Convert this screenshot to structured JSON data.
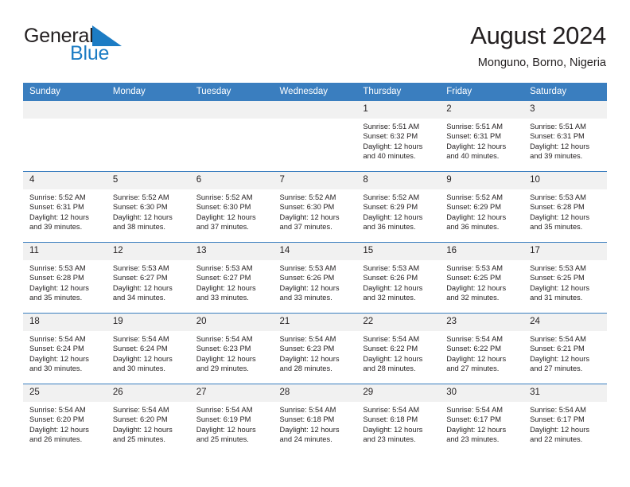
{
  "brand": {
    "name_part1": "General",
    "name_part2": "Blue",
    "logo_icon": "triangle-flag-icon",
    "accent_color": "#1c7cc4"
  },
  "header": {
    "title": "August 2024",
    "subtitle": "Monguno, Borno, Nigeria"
  },
  "calendar": {
    "header_bg": "#3a7ebf",
    "daynum_bg": "#f1f1f1",
    "weekday_headers": [
      "Sunday",
      "Monday",
      "Tuesday",
      "Wednesday",
      "Thursday",
      "Friday",
      "Saturday"
    ],
    "weeks": [
      [
        {
          "day": "",
          "lines": []
        },
        {
          "day": "",
          "lines": []
        },
        {
          "day": "",
          "lines": []
        },
        {
          "day": "",
          "lines": []
        },
        {
          "day": "1",
          "lines": [
            "Sunrise: 5:51 AM",
            "Sunset: 6:32 PM",
            "Daylight: 12 hours",
            "and 40 minutes."
          ]
        },
        {
          "day": "2",
          "lines": [
            "Sunrise: 5:51 AM",
            "Sunset: 6:31 PM",
            "Daylight: 12 hours",
            "and 40 minutes."
          ]
        },
        {
          "day": "3",
          "lines": [
            "Sunrise: 5:51 AM",
            "Sunset: 6:31 PM",
            "Daylight: 12 hours",
            "and 39 minutes."
          ]
        }
      ],
      [
        {
          "day": "4",
          "lines": [
            "Sunrise: 5:52 AM",
            "Sunset: 6:31 PM",
            "Daylight: 12 hours",
            "and 39 minutes."
          ]
        },
        {
          "day": "5",
          "lines": [
            "Sunrise: 5:52 AM",
            "Sunset: 6:30 PM",
            "Daylight: 12 hours",
            "and 38 minutes."
          ]
        },
        {
          "day": "6",
          "lines": [
            "Sunrise: 5:52 AM",
            "Sunset: 6:30 PM",
            "Daylight: 12 hours",
            "and 37 minutes."
          ]
        },
        {
          "day": "7",
          "lines": [
            "Sunrise: 5:52 AM",
            "Sunset: 6:30 PM",
            "Daylight: 12 hours",
            "and 37 minutes."
          ]
        },
        {
          "day": "8",
          "lines": [
            "Sunrise: 5:52 AM",
            "Sunset: 6:29 PM",
            "Daylight: 12 hours",
            "and 36 minutes."
          ]
        },
        {
          "day": "9",
          "lines": [
            "Sunrise: 5:52 AM",
            "Sunset: 6:29 PM",
            "Daylight: 12 hours",
            "and 36 minutes."
          ]
        },
        {
          "day": "10",
          "lines": [
            "Sunrise: 5:53 AM",
            "Sunset: 6:28 PM",
            "Daylight: 12 hours",
            "and 35 minutes."
          ]
        }
      ],
      [
        {
          "day": "11",
          "lines": [
            "Sunrise: 5:53 AM",
            "Sunset: 6:28 PM",
            "Daylight: 12 hours",
            "and 35 minutes."
          ]
        },
        {
          "day": "12",
          "lines": [
            "Sunrise: 5:53 AM",
            "Sunset: 6:27 PM",
            "Daylight: 12 hours",
            "and 34 minutes."
          ]
        },
        {
          "day": "13",
          "lines": [
            "Sunrise: 5:53 AM",
            "Sunset: 6:27 PM",
            "Daylight: 12 hours",
            "and 33 minutes."
          ]
        },
        {
          "day": "14",
          "lines": [
            "Sunrise: 5:53 AM",
            "Sunset: 6:26 PM",
            "Daylight: 12 hours",
            "and 33 minutes."
          ]
        },
        {
          "day": "15",
          "lines": [
            "Sunrise: 5:53 AM",
            "Sunset: 6:26 PM",
            "Daylight: 12 hours",
            "and 32 minutes."
          ]
        },
        {
          "day": "16",
          "lines": [
            "Sunrise: 5:53 AM",
            "Sunset: 6:25 PM",
            "Daylight: 12 hours",
            "and 32 minutes."
          ]
        },
        {
          "day": "17",
          "lines": [
            "Sunrise: 5:53 AM",
            "Sunset: 6:25 PM",
            "Daylight: 12 hours",
            "and 31 minutes."
          ]
        }
      ],
      [
        {
          "day": "18",
          "lines": [
            "Sunrise: 5:54 AM",
            "Sunset: 6:24 PM",
            "Daylight: 12 hours",
            "and 30 minutes."
          ]
        },
        {
          "day": "19",
          "lines": [
            "Sunrise: 5:54 AM",
            "Sunset: 6:24 PM",
            "Daylight: 12 hours",
            "and 30 minutes."
          ]
        },
        {
          "day": "20",
          "lines": [
            "Sunrise: 5:54 AM",
            "Sunset: 6:23 PM",
            "Daylight: 12 hours",
            "and 29 minutes."
          ]
        },
        {
          "day": "21",
          "lines": [
            "Sunrise: 5:54 AM",
            "Sunset: 6:23 PM",
            "Daylight: 12 hours",
            "and 28 minutes."
          ]
        },
        {
          "day": "22",
          "lines": [
            "Sunrise: 5:54 AM",
            "Sunset: 6:22 PM",
            "Daylight: 12 hours",
            "and 28 minutes."
          ]
        },
        {
          "day": "23",
          "lines": [
            "Sunrise: 5:54 AM",
            "Sunset: 6:22 PM",
            "Daylight: 12 hours",
            "and 27 minutes."
          ]
        },
        {
          "day": "24",
          "lines": [
            "Sunrise: 5:54 AM",
            "Sunset: 6:21 PM",
            "Daylight: 12 hours",
            "and 27 minutes."
          ]
        }
      ],
      [
        {
          "day": "25",
          "lines": [
            "Sunrise: 5:54 AM",
            "Sunset: 6:20 PM",
            "Daylight: 12 hours",
            "and 26 minutes."
          ]
        },
        {
          "day": "26",
          "lines": [
            "Sunrise: 5:54 AM",
            "Sunset: 6:20 PM",
            "Daylight: 12 hours",
            "and 25 minutes."
          ]
        },
        {
          "day": "27",
          "lines": [
            "Sunrise: 5:54 AM",
            "Sunset: 6:19 PM",
            "Daylight: 12 hours",
            "and 25 minutes."
          ]
        },
        {
          "day": "28",
          "lines": [
            "Sunrise: 5:54 AM",
            "Sunset: 6:18 PM",
            "Daylight: 12 hours",
            "and 24 minutes."
          ]
        },
        {
          "day": "29",
          "lines": [
            "Sunrise: 5:54 AM",
            "Sunset: 6:18 PM",
            "Daylight: 12 hours",
            "and 23 minutes."
          ]
        },
        {
          "day": "30",
          "lines": [
            "Sunrise: 5:54 AM",
            "Sunset: 6:17 PM",
            "Daylight: 12 hours",
            "and 23 minutes."
          ]
        },
        {
          "day": "31",
          "lines": [
            "Sunrise: 5:54 AM",
            "Sunset: 6:17 PM",
            "Daylight: 12 hours",
            "and 22 minutes."
          ]
        }
      ]
    ]
  }
}
